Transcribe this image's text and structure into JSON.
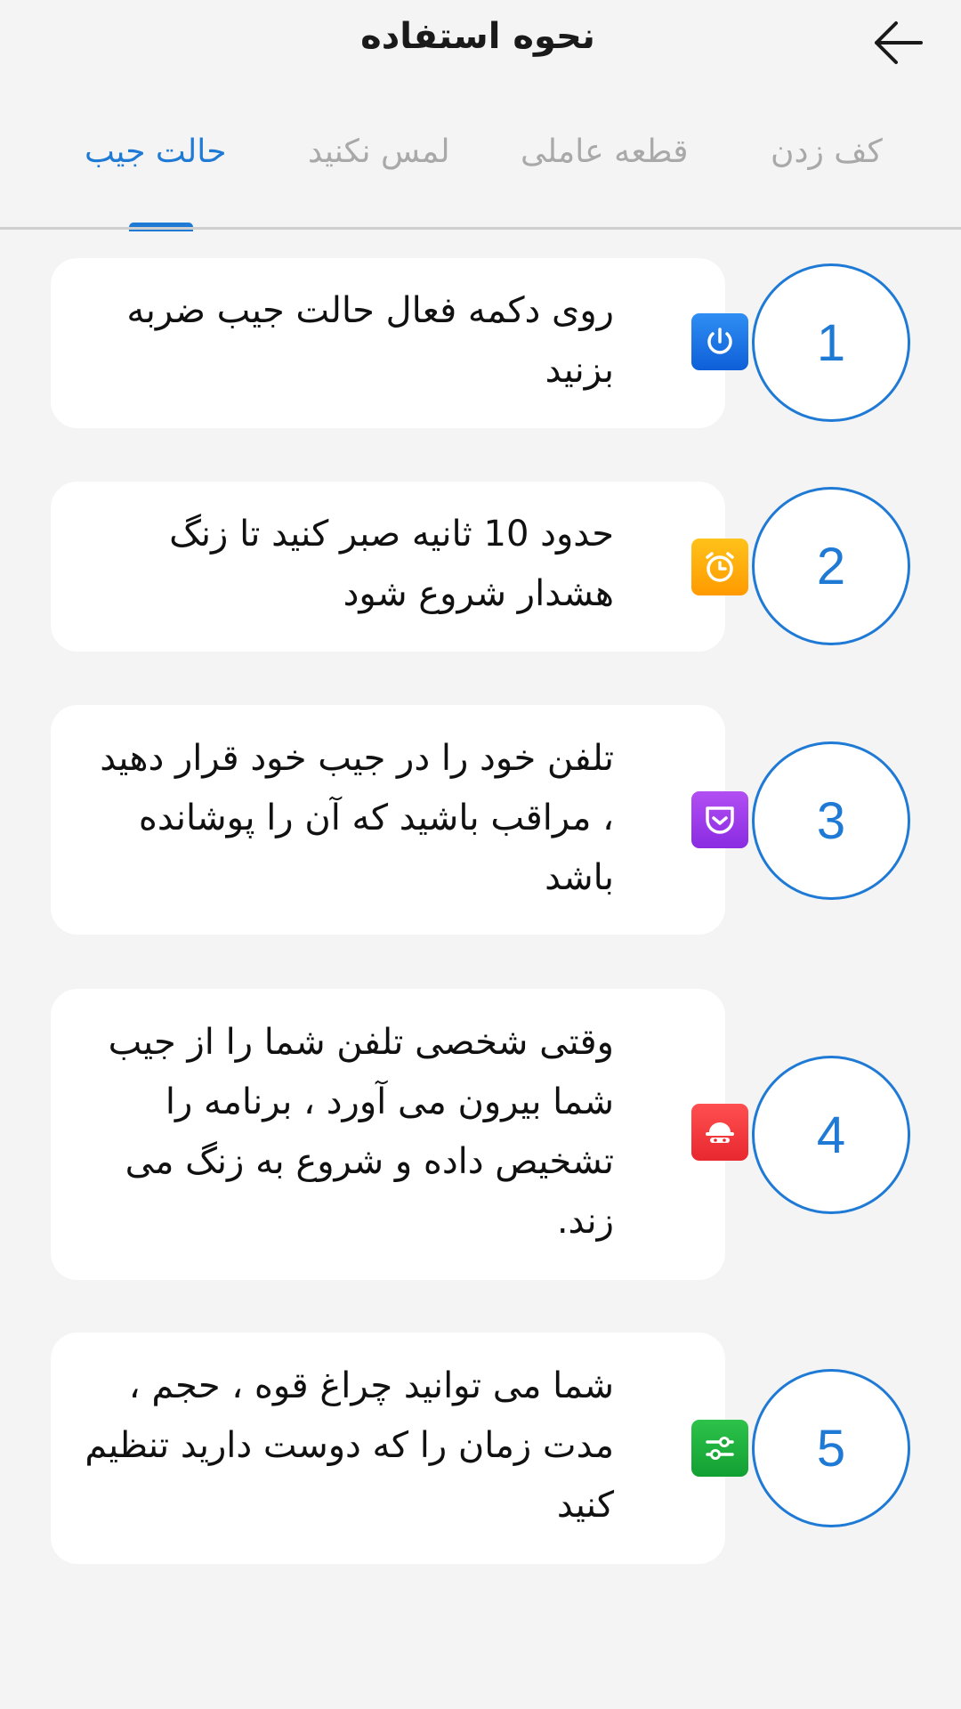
{
  "header": {
    "title": "نحوه استفاده"
  },
  "tabs": [
    {
      "label": "کف زدن",
      "active": false
    },
    {
      "label": "قطعه عاملی",
      "active": false
    },
    {
      "label": "لمس نکنید",
      "active": false
    },
    {
      "label": "حالت جیب",
      "active": true
    }
  ],
  "colors": {
    "accent": "#1f7ad6"
  },
  "steps": [
    {
      "number": "1",
      "text": "روی دکمه فعال حالت جیب ضربه بزنید",
      "icon": "power-icon",
      "icon_colors": [
        "#2f8ef3",
        "#0e5fd8"
      ]
    },
    {
      "number": "2",
      "text": "حدود 10 ثانیه صبر کنید تا زنگ هشدار شروع شود",
      "icon": "alarm-clock-icon",
      "icon_colors": [
        "#ffc21a",
        "#ff9a00"
      ]
    },
    {
      "number": "3",
      "text": "تلفن خود را در جیب خود قرار دهید ، مراقب باشید که آن را پوشانده باشد",
      "icon": "pocket-icon",
      "icon_colors": [
        "#b24ff3",
        "#8a2be2"
      ]
    },
    {
      "number": "4",
      "text": "وقتی شخصی تلفن شما را از جیب شما بیرون می آورد ، برنامه را تشخیص داده و شروع به زنگ می زند.",
      "icon": "thief-icon",
      "icon_colors": [
        "#ff4f4f",
        "#e8282f"
      ]
    },
    {
      "number": "5",
      "text": "شما می توانید چراغ قوه ، حجم ، مدت زمان را که دوست دارید تنظیم کنید",
      "icon": "sliders-icon",
      "icon_colors": [
        "#2dc24a",
        "#12a033"
      ]
    }
  ]
}
